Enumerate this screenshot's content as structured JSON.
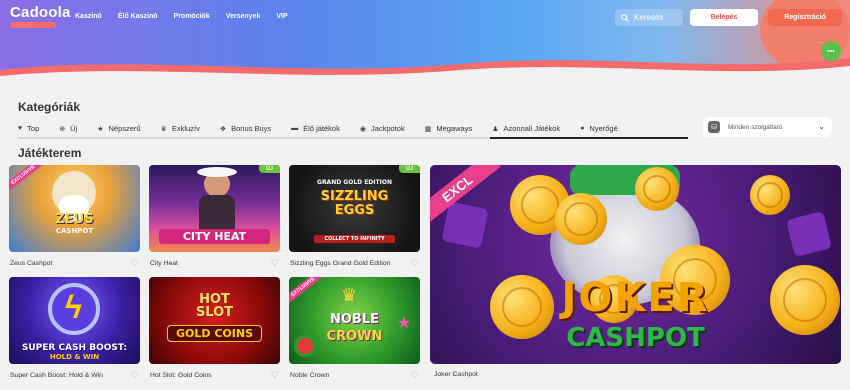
{
  "header": {
    "logo": "Cadoola",
    "nav": [
      "Kaszinó",
      "Élő Kaszinó",
      "Promóciók",
      "Versenyek",
      "VIP"
    ],
    "search_label": "Keresés",
    "login_label": "Belépés",
    "register_label": "Regisztráció",
    "colors": {
      "accent": "#f2694f",
      "gradient_start": "#8a6ee8",
      "gradient_end": "#f48a7a"
    }
  },
  "categories": {
    "title": "Kategóriák",
    "items": [
      {
        "label": "Top",
        "icon": "heart-icon"
      },
      {
        "label": "Új",
        "icon": "plus-circle-icon"
      },
      {
        "label": "Népszerű",
        "icon": "star-icon"
      },
      {
        "label": "Exkluzív",
        "icon": "crown-icon"
      },
      {
        "label": "Bonus Buys",
        "icon": "paw-icon"
      },
      {
        "label": "Élő játékok",
        "icon": "camera-icon"
      },
      {
        "label": "Jackpotok",
        "icon": "coin-icon"
      },
      {
        "label": "Megaways",
        "icon": "grid-icon"
      },
      {
        "label": "Azonnali Játékok",
        "icon": "person-icon"
      },
      {
        "label": "Nyerőgé",
        "icon": "slot-icon"
      }
    ],
    "provider_placeholder": "Minden szolgáltató"
  },
  "games": {
    "title": "Játékterem",
    "new_badge": "ÚJ",
    "exclusive_badge": "EXCLUSIVE",
    "big_badge": "EXCL",
    "cards": [
      {
        "name": "Zeus Cashpot",
        "art": "ZEUS",
        "art2": "CASHPOT"
      },
      {
        "name": "City Heat",
        "art": "CITY HEAT"
      },
      {
        "name": "Sizzling Eggs Grand Gold Edition",
        "art": "SIZZLING EGGS",
        "art2": "GRAND GOLD EDITION",
        "art3": "COLLECT TO INFINITY"
      },
      {
        "name": "Super Cash Boost: Hold & Win",
        "art": "SUPER CASH BOOST:",
        "art2": "HOLD & WIN"
      },
      {
        "name": "Hot Slot: Gold Coins",
        "art": "HOT SLOT",
        "art2": "GOLD COINS"
      },
      {
        "name": "Noble Crown",
        "art": "NOBLE",
        "art2": "CROWN"
      }
    ],
    "featured": {
      "name": "Joker Cashpot",
      "art": "JOKER",
      "art2": "CASHPOT"
    }
  }
}
